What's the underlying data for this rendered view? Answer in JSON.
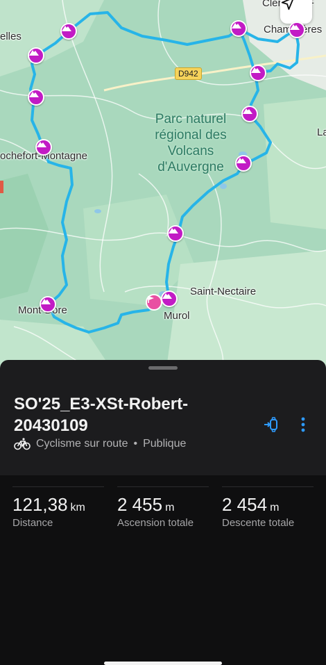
{
  "map": {
    "places": {
      "clermont": "Clermont-F",
      "chamalieres": "Chamalières",
      "orcines": "elles",
      "rochefort": "ochefort-Montagne",
      "saint_nectaire": "Saint-Nectaire",
      "murol": "Murol",
      "mont_dore": "Mont-Dore",
      "la": "La"
    },
    "park_name": "Parc naturel régional des Volcans d'Auvergne",
    "road": "D942",
    "route_color": "#27b4e8",
    "poi_color": "#c21bc5"
  },
  "route": {
    "title": "SO'25_E3-XSt-Robert-20430109",
    "activity": "Cyclisme sur route",
    "separator": "•",
    "visibility": "Publique"
  },
  "stats": [
    {
      "value": "121,38",
      "unit": "km",
      "label": "Distance"
    },
    {
      "value": "2 455",
      "unit": "m",
      "label": "Ascension totale"
    },
    {
      "value": "2 454",
      "unit": "m",
      "label": "Descente totale"
    }
  ]
}
